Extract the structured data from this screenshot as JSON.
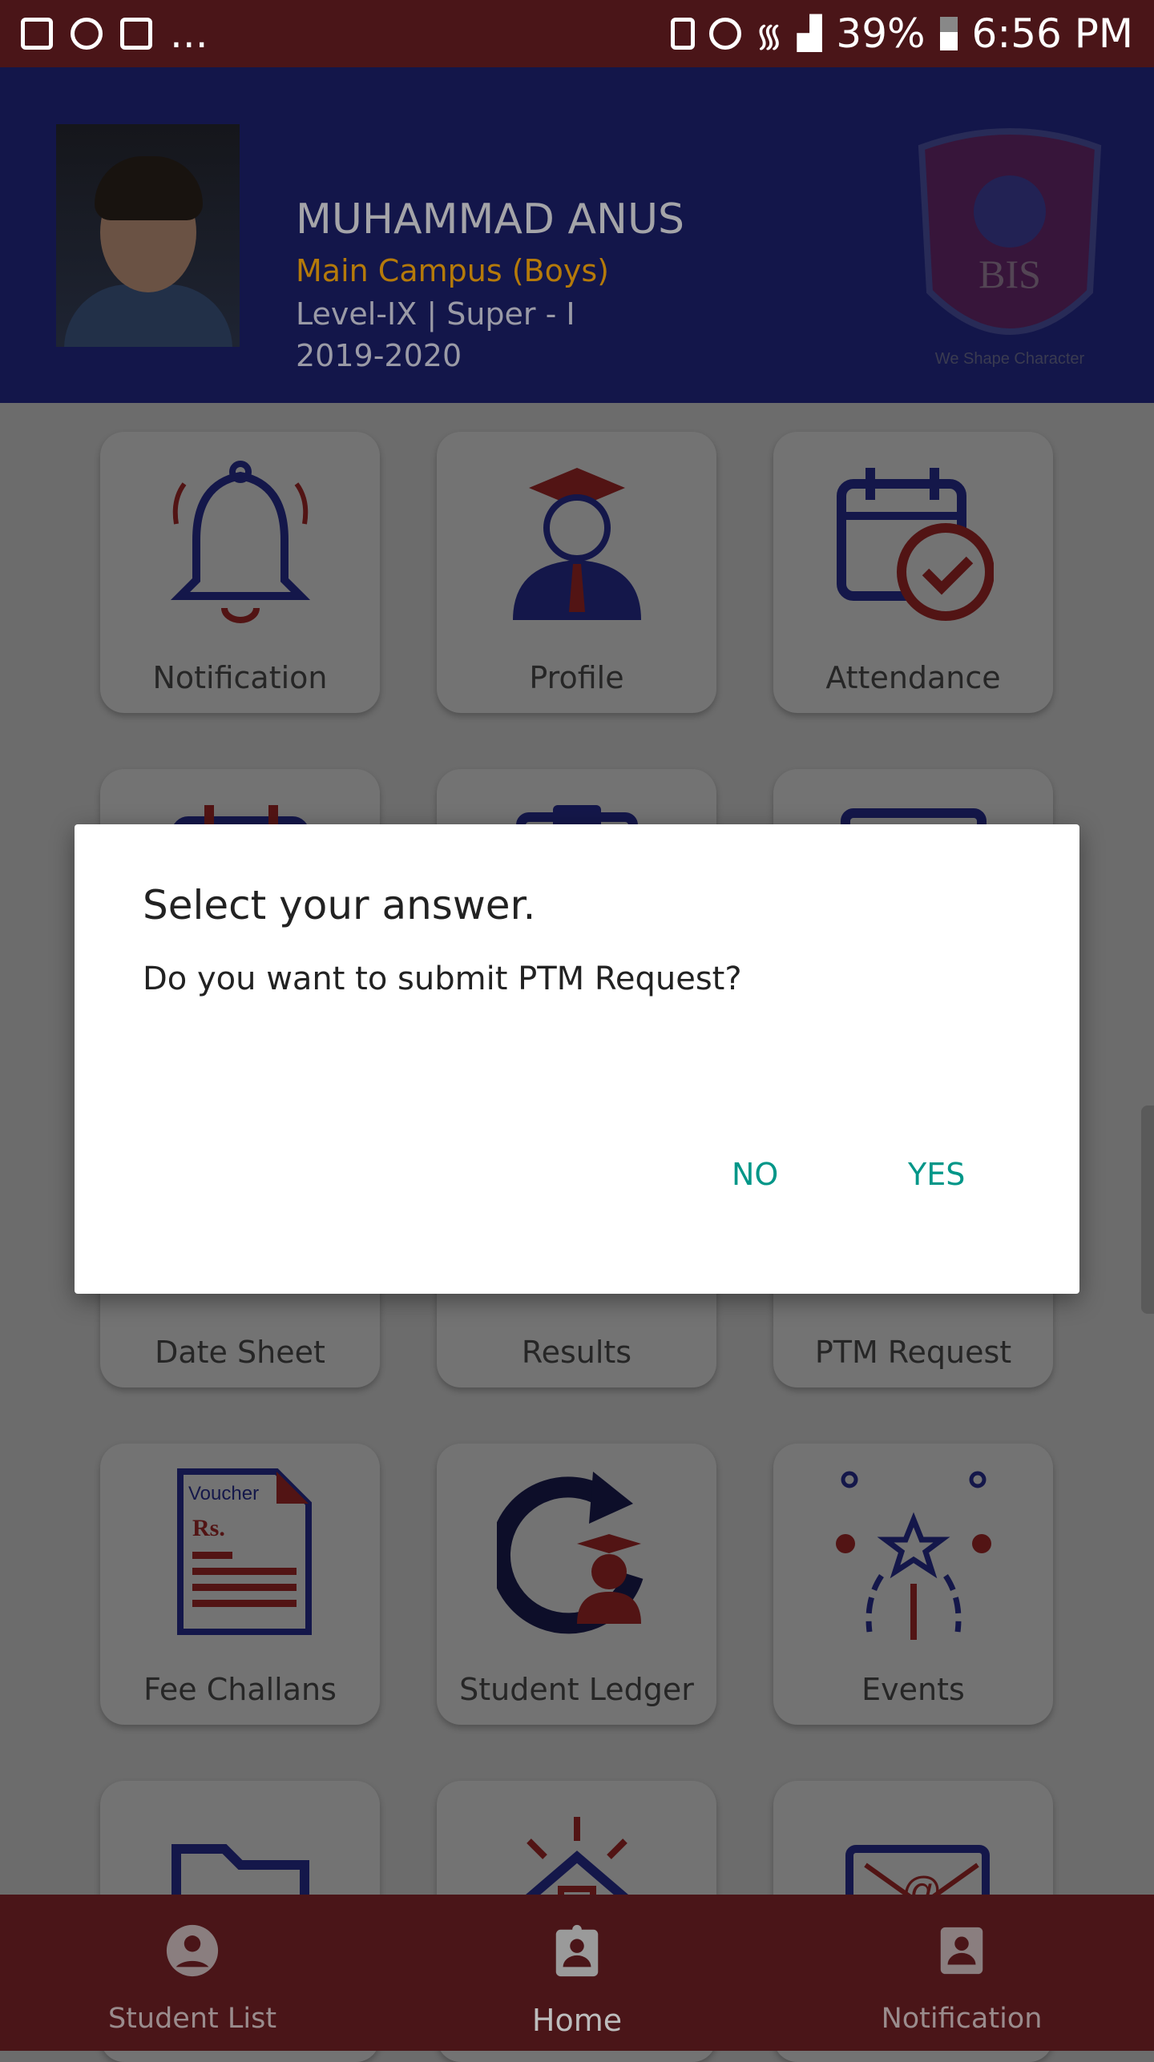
{
  "status_bar": {
    "battery": "39%",
    "time": "6:56 PM",
    "notification_icons": [
      "gallery-icon",
      "whatsapp-icon",
      "gmail-icon"
    ],
    "more": "..."
  },
  "header": {
    "name": "MUHAMMAD ANUS",
    "campus": "Main Campus (Boys)",
    "level": "Level-IX | Super - I",
    "session": "2019-2020",
    "logo_text": "BIS",
    "logo_motto": "We Shape Character"
  },
  "tiles": [
    {
      "label": "Notification",
      "icon": "bell-icon"
    },
    {
      "label": "Profile",
      "icon": "graduate-icon"
    },
    {
      "label": "Attendance",
      "icon": "calendar-check-icon"
    },
    {
      "label": "",
      "icon": "calendar-icon"
    },
    {
      "label": "",
      "icon": "clipboard-icon"
    },
    {
      "label": "",
      "icon": "monitor-icon"
    },
    {
      "label": "Date Sheet",
      "icon": "date-sheet-icon"
    },
    {
      "label": "Results",
      "icon": "results-icon"
    },
    {
      "label": "PTM Request",
      "icon": "ptm-icon"
    },
    {
      "label": "Fee Challans",
      "icon": "voucher-icon",
      "voucher_text": "Voucher",
      "currency": "Rs."
    },
    {
      "label": "Student Ledger",
      "icon": "ledger-icon"
    },
    {
      "label": "Events",
      "icon": "fireworks-icon"
    },
    {
      "label": "",
      "icon": "folder-icon"
    },
    {
      "label": "",
      "icon": "school-icon"
    },
    {
      "label": "",
      "icon": "email-icon"
    }
  ],
  "dialog": {
    "title": "Select your answer.",
    "message": "Do you want to submit PTM Request?",
    "no_label": "NO",
    "yes_label": "YES"
  },
  "bottom_nav": [
    {
      "label": "Student List",
      "icon": "account-circle-icon"
    },
    {
      "label": "Home",
      "icon": "badge-icon",
      "active": true
    },
    {
      "label": "Notification",
      "icon": "contact-icon"
    }
  ],
  "colors": {
    "primary": "#2c3490",
    "accent": "#b22a2a",
    "status_bar": "#4a1518",
    "dialog_button": "#009688",
    "campus_text": "#f0a010"
  }
}
